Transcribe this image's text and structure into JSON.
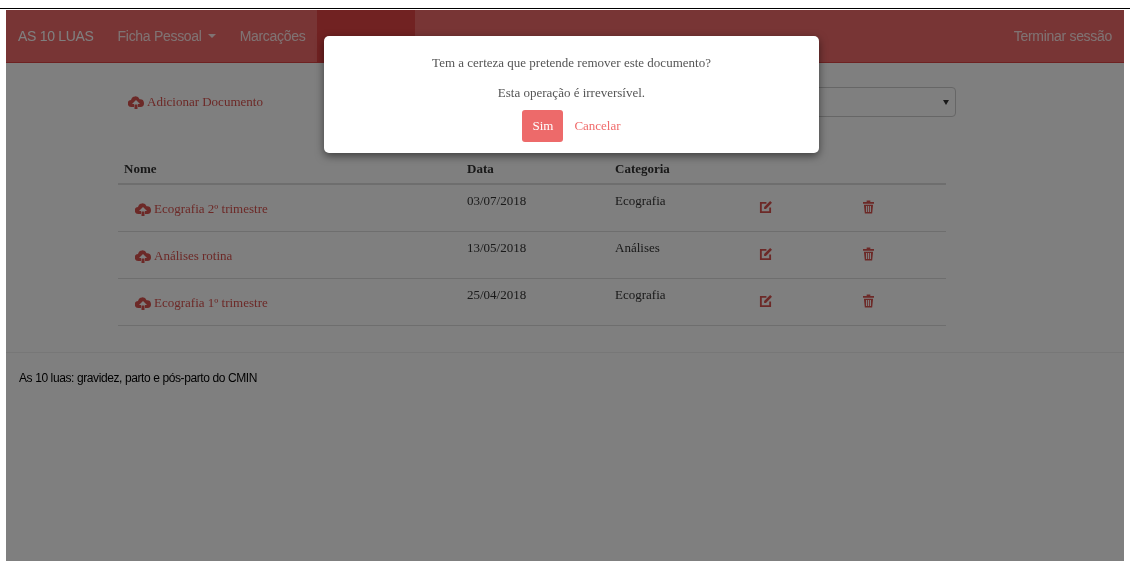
{
  "navbar": {
    "brand": "AS 10 LUAS",
    "items": [
      {
        "label": "Ficha Pessoal",
        "kind": "dropdown",
        "selected": false
      },
      {
        "label": "Marcações",
        "kind": "link",
        "selected": false
      },
      {
        "kind": "covered",
        "selected": true
      }
    ],
    "logout": "Terminar sessão"
  },
  "add_document": "Adicionar Documento",
  "table": {
    "columns": [
      "Nome",
      "Data",
      "Categoria"
    ],
    "rows": [
      {
        "name": "Ecografia 2º trimestre",
        "date": "03/07/2018",
        "category": "Ecografia"
      },
      {
        "name": "Análises rotina",
        "date": "13/05/2018",
        "category": "Análises"
      },
      {
        "name": "Ecografia 1º trimestre",
        "date": "25/04/2018",
        "category": "Ecografia"
      }
    ]
  },
  "footer": "As 10 luas: gravidez, parto e pós-parto do CMIN",
  "dialog": {
    "question": "Tem a certeza que pretende remover este documento?",
    "note": "Esta operação é irreversível.",
    "buttons": [
      {
        "label": "Sim",
        "kind": "primary"
      },
      {
        "label": "Cancelar",
        "kind": "link"
      }
    ]
  }
}
